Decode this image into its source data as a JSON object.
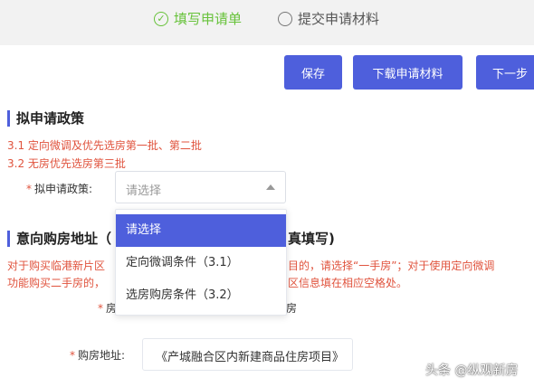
{
  "steps": [
    {
      "label": "填写申请单",
      "icon": "check-circle-icon",
      "active": true
    },
    {
      "label": "提交申请材料",
      "icon": "radio-circle-icon",
      "active": false
    }
  ],
  "toolbar": {
    "save": "保存",
    "download": "下载申请材料",
    "next": "下一步"
  },
  "section1": {
    "title": "拟申请政策",
    "notes": [
      "3.1 定向微调及优先选房第一批、第二批",
      "3.2 无房优先选房第三批"
    ],
    "policy_label": "拟申请政策:",
    "policy_placeholder": "请选择"
  },
  "dropdown": {
    "options": [
      "请选择",
      "定向微调条件（3.1）",
      "选房购房条件（3.2）"
    ],
    "selected_index": 0
  },
  "section2": {
    "title_start": "意向购房地址（",
    "title_end": "真填写)",
    "note_line1_start": "对于购买临港新片区",
    "note_line1_end": "目的，请选择“一手房”；对于使用定向微调",
    "note_line2_start": "功能购买二手房的，",
    "note_line2_end": "区信息填在相应空格处。",
    "house_label_start": "房",
    "house_label_end": "房",
    "address_label": "购房地址:",
    "address_value": "《产城融合区内新建商品住房项目》"
  },
  "watermark": "头条 @纵观新房",
  "colors": {
    "primary": "#4e5fdc",
    "success": "#67c23a",
    "danger": "#e0533d"
  }
}
